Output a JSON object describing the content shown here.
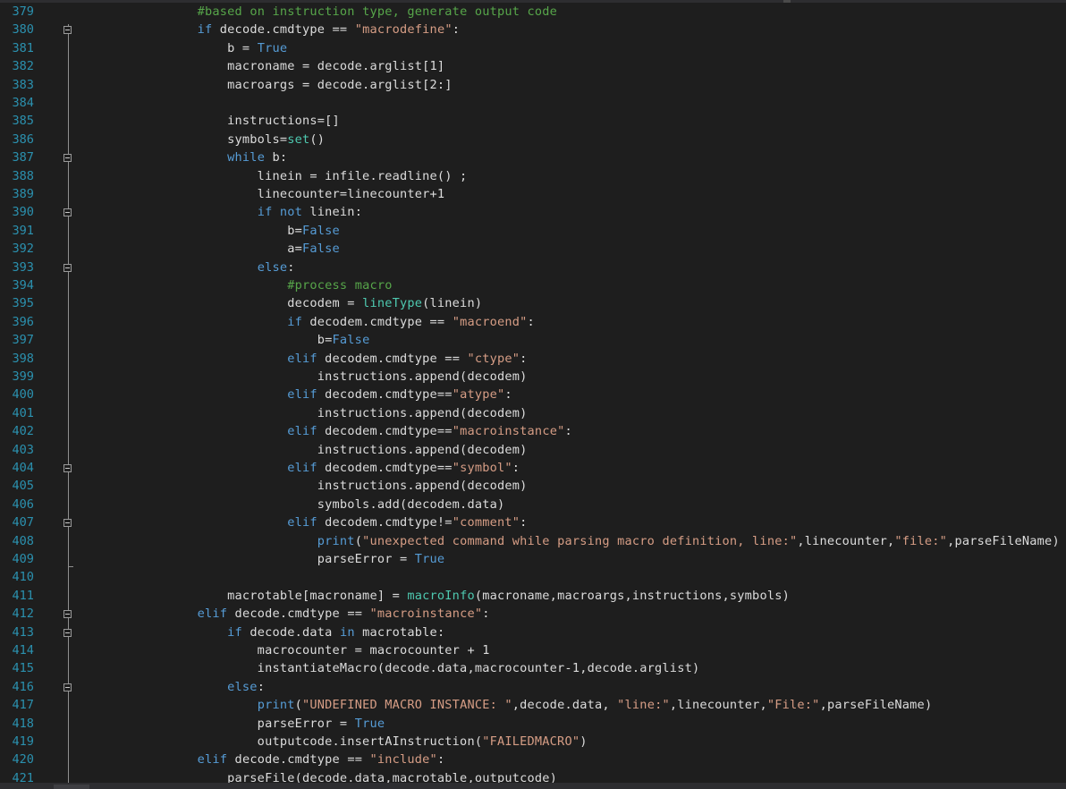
{
  "editor": {
    "lines": [
      {
        "n": "379",
        "tokens": [
          [
            "            ",
            ""
          ],
          [
            "#based on instruction type, generate output code",
            "cm"
          ]
        ]
      },
      {
        "n": "380",
        "tokens": [
          [
            "            ",
            ""
          ],
          [
            "if",
            "kw"
          ],
          [
            " decode.cmdtype == ",
            ""
          ],
          [
            "\"macrodefine\"",
            "str"
          ],
          [
            ":",
            ""
          ]
        ]
      },
      {
        "n": "381",
        "tokens": [
          [
            "                b = ",
            ""
          ],
          [
            "True",
            "kw"
          ]
        ]
      },
      {
        "n": "382",
        "tokens": [
          [
            "                macroname = decode.arglist[1]",
            ""
          ]
        ]
      },
      {
        "n": "383",
        "tokens": [
          [
            "                macroargs = decode.arglist[2:]",
            ""
          ]
        ]
      },
      {
        "n": "384",
        "tokens": []
      },
      {
        "n": "385",
        "tokens": [
          [
            "                instructions=[]",
            ""
          ]
        ]
      },
      {
        "n": "386",
        "tokens": [
          [
            "                symbols=",
            ""
          ],
          [
            "set",
            "fn"
          ],
          [
            "()",
            ""
          ]
        ]
      },
      {
        "n": "387",
        "tokens": [
          [
            "                ",
            ""
          ],
          [
            "while",
            "kw"
          ],
          [
            " b:",
            ""
          ]
        ]
      },
      {
        "n": "388",
        "tokens": [
          [
            "                    linein = infile.readline() ;",
            ""
          ]
        ]
      },
      {
        "n": "389",
        "tokens": [
          [
            "                    linecounter=linecounter+1",
            ""
          ]
        ]
      },
      {
        "n": "390",
        "tokens": [
          [
            "                    ",
            ""
          ],
          [
            "if not",
            "kw"
          ],
          [
            " linein:",
            ""
          ]
        ]
      },
      {
        "n": "391",
        "tokens": [
          [
            "                        b=",
            ""
          ],
          [
            "False",
            "kw"
          ]
        ]
      },
      {
        "n": "392",
        "tokens": [
          [
            "                        a=",
            ""
          ],
          [
            "False",
            "kw"
          ]
        ]
      },
      {
        "n": "393",
        "tokens": [
          [
            "                    ",
            ""
          ],
          [
            "else",
            "kw"
          ],
          [
            ":",
            ""
          ]
        ]
      },
      {
        "n": "394",
        "tokens": [
          [
            "                        ",
            ""
          ],
          [
            "#process macro",
            "cm"
          ]
        ]
      },
      {
        "n": "395",
        "tokens": [
          [
            "                        decodem = ",
            ""
          ],
          [
            "lineType",
            "fn"
          ],
          [
            "(linein)",
            ""
          ]
        ]
      },
      {
        "n": "396",
        "tokens": [
          [
            "                        ",
            ""
          ],
          [
            "if",
            "kw"
          ],
          [
            " decodem.cmdtype == ",
            ""
          ],
          [
            "\"macroend\"",
            "str"
          ],
          [
            ":",
            ""
          ]
        ]
      },
      {
        "n": "397",
        "tokens": [
          [
            "                            b=",
            ""
          ],
          [
            "False",
            "kw"
          ]
        ]
      },
      {
        "n": "398",
        "tokens": [
          [
            "                        ",
            ""
          ],
          [
            "elif",
            "kw"
          ],
          [
            " decodem.cmdtype == ",
            ""
          ],
          [
            "\"ctype\"",
            "str"
          ],
          [
            ":",
            ""
          ]
        ]
      },
      {
        "n": "399",
        "tokens": [
          [
            "                            instructions.append(decodem)",
            ""
          ]
        ]
      },
      {
        "n": "400",
        "tokens": [
          [
            "                        ",
            ""
          ],
          [
            "elif",
            "kw"
          ],
          [
            " decodem.cmdtype==",
            ""
          ],
          [
            "\"atype\"",
            "str"
          ],
          [
            ":",
            ""
          ]
        ]
      },
      {
        "n": "401",
        "tokens": [
          [
            "                            instructions.append(decodem)",
            ""
          ]
        ]
      },
      {
        "n": "402",
        "tokens": [
          [
            "                        ",
            ""
          ],
          [
            "elif",
            "kw"
          ],
          [
            " decodem.cmdtype==",
            ""
          ],
          [
            "\"macroinstance\"",
            "str"
          ],
          [
            ":",
            ""
          ]
        ]
      },
      {
        "n": "403",
        "tokens": [
          [
            "                            instructions.append(decodem)",
            ""
          ]
        ]
      },
      {
        "n": "404",
        "tokens": [
          [
            "                        ",
            ""
          ],
          [
            "elif",
            "kw"
          ],
          [
            " decodem.cmdtype==",
            ""
          ],
          [
            "\"symbol\"",
            "str"
          ],
          [
            ":",
            ""
          ]
        ]
      },
      {
        "n": "405",
        "tokens": [
          [
            "                            instructions.append(decodem)",
            ""
          ]
        ]
      },
      {
        "n": "406",
        "tokens": [
          [
            "                            symbols.add(decodem.data)",
            ""
          ]
        ]
      },
      {
        "n": "407",
        "tokens": [
          [
            "                        ",
            ""
          ],
          [
            "elif",
            "kw"
          ],
          [
            " decodem.cmdtype!=",
            ""
          ],
          [
            "\"comment\"",
            "str"
          ],
          [
            ":",
            ""
          ]
        ]
      },
      {
        "n": "408",
        "tokens": [
          [
            "                            ",
            ""
          ],
          [
            "print",
            "kw"
          ],
          [
            "(",
            ""
          ],
          [
            "\"unexpected command while parsing macro definition, line:\"",
            "str"
          ],
          [
            ",linecounter,",
            ""
          ],
          [
            "\"file:\"",
            "str"
          ],
          [
            ",parseFileName)",
            ""
          ]
        ]
      },
      {
        "n": "409",
        "tokens": [
          [
            "                            parseError = ",
            ""
          ],
          [
            "True",
            "kw"
          ]
        ]
      },
      {
        "n": "410",
        "tokens": []
      },
      {
        "n": "411",
        "tokens": [
          [
            "                macrotable[macroname] = ",
            ""
          ],
          [
            "macroInfo",
            "fn"
          ],
          [
            "(macroname,macroargs,instructions,symbols)",
            ""
          ]
        ]
      },
      {
        "n": "412",
        "tokens": [
          [
            "            ",
            ""
          ],
          [
            "elif",
            "kw"
          ],
          [
            " decode.cmdtype == ",
            ""
          ],
          [
            "\"macroinstance\"",
            "str"
          ],
          [
            ":",
            ""
          ]
        ]
      },
      {
        "n": "413",
        "tokens": [
          [
            "                ",
            ""
          ],
          [
            "if",
            "kw"
          ],
          [
            " decode.data ",
            ""
          ],
          [
            "in",
            "kw"
          ],
          [
            " macrotable:",
            ""
          ]
        ]
      },
      {
        "n": "414",
        "tokens": [
          [
            "                    macrocounter = macrocounter + 1",
            ""
          ]
        ]
      },
      {
        "n": "415",
        "tokens": [
          [
            "                    instantiateMacro(decode.data,macrocounter-1,decode.arglist)",
            ""
          ]
        ]
      },
      {
        "n": "416",
        "tokens": [
          [
            "                ",
            ""
          ],
          [
            "else",
            "kw"
          ],
          [
            ":",
            ""
          ]
        ]
      },
      {
        "n": "417",
        "tokens": [
          [
            "                    ",
            ""
          ],
          [
            "print",
            "kw"
          ],
          [
            "(",
            ""
          ],
          [
            "\"UNDEFINED MACRO INSTANCE: \"",
            "str"
          ],
          [
            ",decode.data, ",
            ""
          ],
          [
            "\"line:\"",
            "str"
          ],
          [
            ",linecounter,",
            ""
          ],
          [
            "\"File:\"",
            "str"
          ],
          [
            ",parseFileName)",
            ""
          ]
        ]
      },
      {
        "n": "418",
        "tokens": [
          [
            "                    parseError = ",
            ""
          ],
          [
            "True",
            "kw"
          ]
        ]
      },
      {
        "n": "419",
        "tokens": [
          [
            "                    outputcode.insertAInstruction(",
            ""
          ],
          [
            "\"FAILEDMACRO\"",
            "str"
          ],
          [
            ")",
            ""
          ]
        ]
      },
      {
        "n": "420",
        "tokens": [
          [
            "            ",
            ""
          ],
          [
            "elif",
            "kw"
          ],
          [
            " decode.cmdtype == ",
            ""
          ],
          [
            "\"include\"",
            "str"
          ],
          [
            ":",
            ""
          ]
        ]
      },
      {
        "n": "421",
        "tokens": [
          [
            "                parseFile(decode.data,macrotable,outputcode)",
            ""
          ]
        ]
      }
    ],
    "fold_buttons": [
      "380",
      "387",
      "390",
      "393",
      "404",
      "407",
      "412",
      "413",
      "416"
    ],
    "fold_ends": [
      "409"
    ],
    "colors": {
      "background": "#1e1e1e",
      "line_number": "#2b91af",
      "text": "#dcdcdc",
      "keyword": "#569cd6",
      "string": "#d69d85",
      "comment": "#57a64a",
      "type": "#4ec9b0"
    },
    "language": "python"
  }
}
